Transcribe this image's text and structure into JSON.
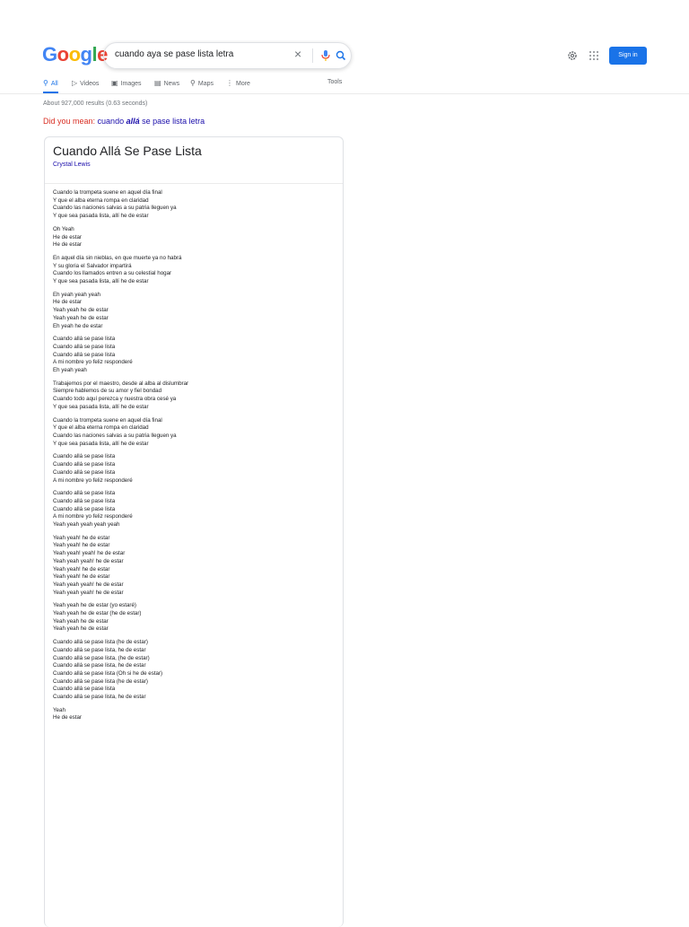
{
  "header": {
    "logo_letters": [
      {
        "ch": "G",
        "color": "#4285f4"
      },
      {
        "ch": "o",
        "color": "#ea4335"
      },
      {
        "ch": "o",
        "color": "#fbbc05"
      },
      {
        "ch": "g",
        "color": "#4285f4"
      },
      {
        "ch": "l",
        "color": "#34a853"
      },
      {
        "ch": "e",
        "color": "#ea4335"
      }
    ],
    "search_query": "cuando aya se pase lista letra",
    "sign_in_label": "Sign in"
  },
  "tabs": [
    {
      "label": "All",
      "icon": "search-icon",
      "glyph": "⚲"
    },
    {
      "label": "Videos",
      "icon": "video-icon",
      "glyph": "▷"
    },
    {
      "label": "Images",
      "icon": "image-icon",
      "glyph": "▣"
    },
    {
      "label": "News",
      "icon": "news-icon",
      "glyph": "▤"
    },
    {
      "label": "Maps",
      "icon": "map-pin-icon",
      "glyph": "⚲"
    },
    {
      "label": "More",
      "icon": "more-icon",
      "glyph": "⋮"
    }
  ],
  "tools_label": "Tools",
  "results_stats": "About 927,000 results (0.63 seconds)",
  "did_you_mean": {
    "prefix": "Did you mean:",
    "part1": "cuando ",
    "emph": "allá",
    "part2": " se pase lista letra"
  },
  "lyrics_card": {
    "title": "Cuando Allá Se Pase Lista",
    "artist": "Crystal Lewis",
    "stanzas": [
      [
        "Cuando la trompeta suene en aquel día final",
        "Y que el alba eterna rompa en claridad",
        "Cuando las naciones salvas a su patria lleguen ya",
        "Y que sea pasada lista, allí he de estar"
      ],
      [
        "Oh Yeah",
        "He de estar",
        "He de estar"
      ],
      [
        "En aquel día sin nieblas, en que muerte ya no habrá",
        "Y su gloria el Salvador impartirá",
        "Cuando los llamados entren a su celestial hogar",
        "Y que sea pasada lista, allí he de estar"
      ],
      [
        "Eh yeah yeah yeah",
        "He de estar",
        "Yeah yeah he de estar",
        "Yeah yeah he de estar",
        "Eh yeah he de estar"
      ],
      [
        "Cuando allá se pase lista",
        "Cuando allá se pase lista",
        "Cuando allá se pase lista",
        "A mi nombre yo feliz responderé",
        "Eh yeah yeah"
      ],
      [
        "Trabajemos por el maestro, desde al alba al dislumbrar",
        "Siempre hablemos de su amor y fiel bondad",
        "Cuando todo aquí perezca y nuestra obra cesé ya",
        "Y que sea pasada lista, allí he de estar"
      ],
      [
        "Cuando la trompeta suene en aquel día final",
        "Y que el alba eterna rompa en claridad",
        "Cuando las naciones salvas a su patria lleguen ya",
        "Y que sea pasada lista, allí he de estar"
      ],
      [
        "Cuando allá se pase lista",
        "Cuando allá se pase lista",
        "Cuando allá se pase lista",
        "A mi nombre yo feliz responderé"
      ],
      [
        "Cuando allá se pase lista",
        "Cuando allá se pase lista",
        "Cuando allá se pase lista",
        "A mi nombre yo feliz responderé",
        "Yeah yeah yeah yeah yeah"
      ],
      [
        "Yeah yeah! he de estar",
        "Yeah yeah! he de estar",
        "Yeah yeah! yeah! he de estar",
        "Yeah yeah yeah! he de estar",
        "Yeah yeah! he de estar",
        "Yeah yeah! he de estar",
        "Yeah yeah yeah! he de estar",
        "Yeah yeah yeah! he de estar"
      ],
      [
        "Yeah yeah he de estar (yo estaré)",
        "Yeah yeah he de estar (he de estar)",
        "Yeah yeah he de estar",
        "Yeah yeah he de estar"
      ],
      [
        "Cuando allá se pase lista (he de estar)",
        "Cuando allá se pase lista, he de estar",
        "Cuando allá se pase lista, (he de estar)",
        "Cuando allá se pase lista, he de estar",
        "Cuando allá se pase lista (Oh si he de estar)",
        "Cuando allá se pase lista (he de estar)",
        "Cuando allá se pase lista",
        "Cuando allá se pase lista, he de estar"
      ],
      [
        "Yeah",
        "He de estar"
      ]
    ]
  }
}
